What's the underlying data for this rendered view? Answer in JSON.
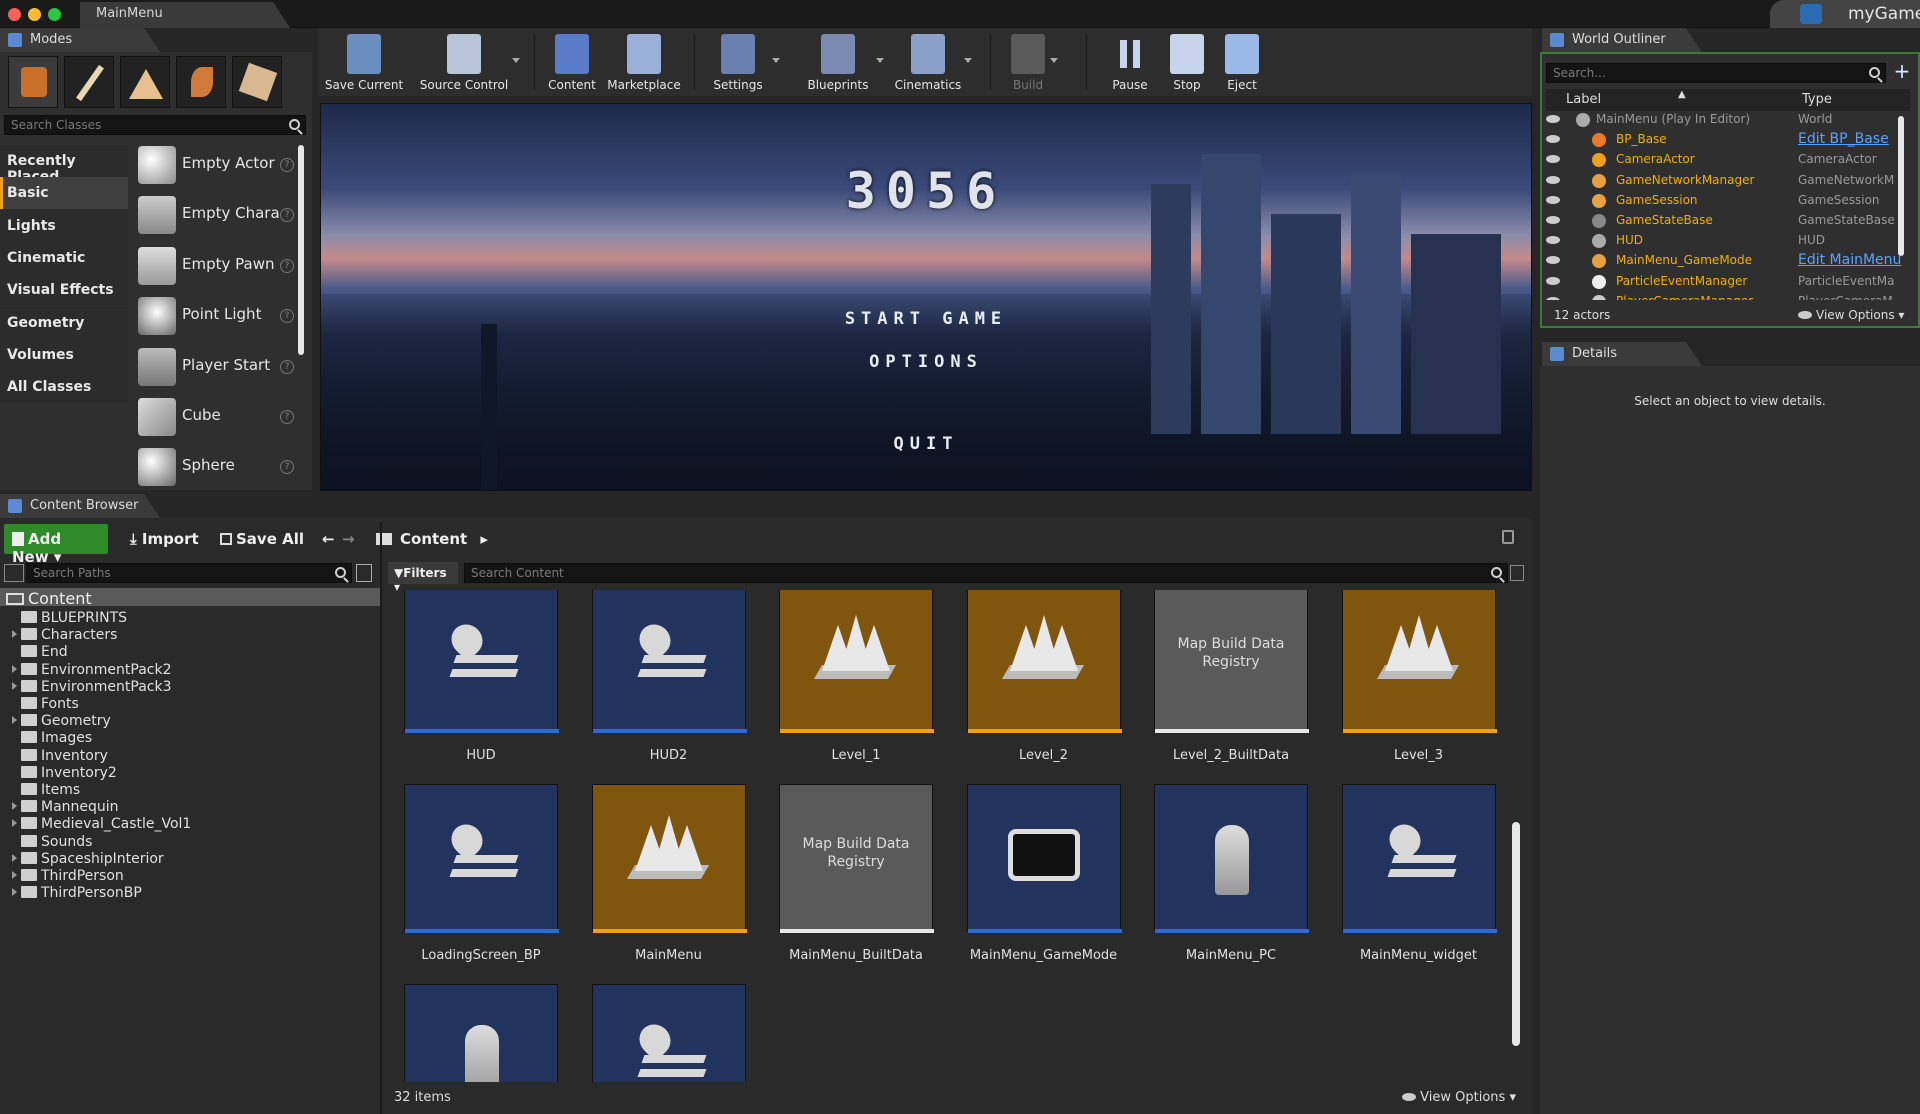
{
  "window": {
    "tab": "MainMenu",
    "project": "myGame"
  },
  "modes": {
    "title": "Modes",
    "search_placeholder": "Search Classes",
    "categories": [
      "Recently Placed",
      "Basic",
      "Lights",
      "Cinematic",
      "Visual Effects",
      "Geometry",
      "Volumes",
      "All Classes"
    ],
    "selected_category": "Basic",
    "items": [
      "Empty Actor",
      "Empty Chara",
      "Empty Pawn",
      "Point Light",
      "Player Start",
      "Cube",
      "Sphere"
    ]
  },
  "toolbar": {
    "buttons": [
      {
        "label": "Save Current",
        "icon": "save-icon"
      },
      {
        "label": "Source Control",
        "icon": "source-control-icon"
      },
      {
        "label": "Content",
        "icon": "content-icon"
      },
      {
        "label": "Marketplace",
        "icon": "marketplace-icon"
      },
      {
        "label": "Settings",
        "icon": "settings-icon"
      },
      {
        "label": "Blueprints",
        "icon": "blueprints-icon"
      },
      {
        "label": "Cinematics",
        "icon": "cinematics-icon"
      },
      {
        "label": "Build",
        "icon": "build-icon"
      },
      {
        "label": "Pause",
        "icon": "pause-icon"
      },
      {
        "label": "Stop",
        "icon": "stop-icon"
      },
      {
        "label": "Eject",
        "icon": "eject-icon"
      }
    ]
  },
  "viewport": {
    "game_title": "3056",
    "menu": [
      "START GAME",
      "OPTIONS",
      "QUIT"
    ]
  },
  "outliner": {
    "title": "World Outliner",
    "search_placeholder": "Search...",
    "col_label": "Label",
    "col_type": "Type",
    "rows": [
      {
        "label": "MainMenu (Play In Editor)",
        "type": "World"
      },
      {
        "label": "BP_Base",
        "type": "Edit BP_Base"
      },
      {
        "label": "CameraActor",
        "type": "CameraActor"
      },
      {
        "label": "GameNetworkManager",
        "type": "GameNetworkM"
      },
      {
        "label": "GameSession",
        "type": "GameSession"
      },
      {
        "label": "GameStateBase",
        "type": "GameStateBase"
      },
      {
        "label": "HUD",
        "type": "HUD"
      },
      {
        "label": "MainMenu_GameMode",
        "type": "Edit MainMenu"
      },
      {
        "label": "ParticleEventManager",
        "type": "ParticleEventMa"
      },
      {
        "label": "PlayerCameraManager",
        "type": "PlayerCameraM"
      }
    ],
    "count": "12 actors",
    "view_options": "View Options"
  },
  "details": {
    "title": "Details",
    "empty": "Select an object to view details."
  },
  "content_browser": {
    "title": "Content Browser",
    "add_new": "Add New",
    "import": "Import",
    "save_all": "Save All",
    "path": "Content",
    "search_paths": "Search Paths",
    "filters": "Filters",
    "search_content": "Search Content",
    "tree_root": "Content",
    "folders": [
      {
        "name": "BLUEPRINTS",
        "exp": false
      },
      {
        "name": "Characters",
        "exp": true
      },
      {
        "name": "End",
        "exp": false
      },
      {
        "name": "EnvironmentPack2",
        "exp": true
      },
      {
        "name": "EnvironmentPack3",
        "exp": true
      },
      {
        "name": "Fonts",
        "exp": false
      },
      {
        "name": "Geometry",
        "exp": true
      },
      {
        "name": "Images",
        "exp": false
      },
      {
        "name": "Inventory",
        "exp": false
      },
      {
        "name": "Inventory2",
        "exp": false
      },
      {
        "name": "Items",
        "exp": false
      },
      {
        "name": "Mannequin",
        "exp": true
      },
      {
        "name": "Medieval_Castle_Vol1",
        "exp": true
      },
      {
        "name": "Sounds",
        "exp": false
      },
      {
        "name": "SpaceshipInterior",
        "exp": true
      },
      {
        "name": "ThirdPerson",
        "exp": true
      },
      {
        "name": "ThirdPersonBP",
        "exp": true
      }
    ],
    "assets": [
      {
        "name": "HUD",
        "kind": "widget"
      },
      {
        "name": "HUD2",
        "kind": "widget"
      },
      {
        "name": "Level_1",
        "kind": "level"
      },
      {
        "name": "Level_2",
        "kind": "level"
      },
      {
        "name": "Level_2_BuiltData",
        "kind": "map",
        "tile_text": "Map Build Data Registry"
      },
      {
        "name": "Level_3",
        "kind": "level"
      },
      {
        "name": "LoadingScreen_BP",
        "kind": "widget"
      },
      {
        "name": "MainMenu",
        "kind": "level"
      },
      {
        "name": "MainMenu_BuiltData",
        "kind": "map",
        "tile_text": "Map Build Data Registry"
      },
      {
        "name": "MainMenu_GameMode",
        "kind": "gamemode"
      },
      {
        "name": "MainMenu_PC",
        "kind": "controller"
      },
      {
        "name": "MainMenu_widget",
        "kind": "widget"
      },
      {
        "name": "",
        "kind": "controller"
      },
      {
        "name": "",
        "kind": "widget"
      }
    ],
    "item_count": "32 items",
    "view_options": "View Options"
  }
}
